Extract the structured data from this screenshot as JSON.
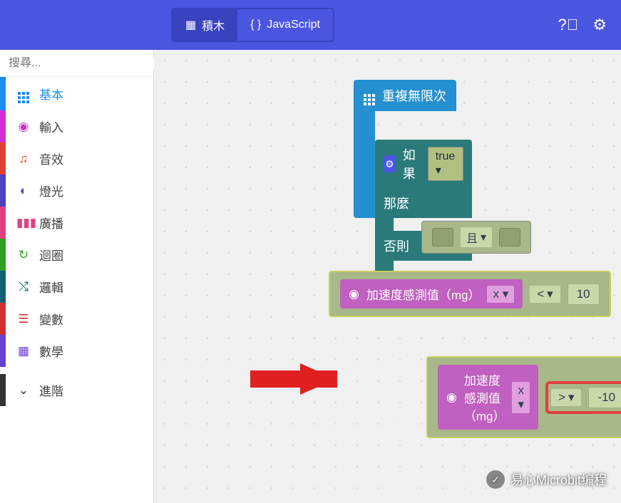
{
  "header": {
    "tab_blocks": "積木",
    "tab_js": "JavaScript"
  },
  "search": {
    "placeholder": "搜尋..."
  },
  "categories": {
    "basic": "基本",
    "input": "輸入",
    "sound": "音效",
    "light": "燈光",
    "radio": "廣播",
    "loop": "迴圈",
    "logic": "邏輯",
    "variables": "變數",
    "math": "數學",
    "advanced": "進階"
  },
  "blocks": {
    "forever": "重複無限次",
    "if": "如果",
    "then": "那麼",
    "else": "否則",
    "true": "true",
    "and": "且",
    "accel": "加速度感測值（mg）",
    "axis": "x",
    "op_lt": "<",
    "op_gt": ">",
    "val1": "10",
    "val2": "-10"
  },
  "watermark": "易心Microbit编程"
}
